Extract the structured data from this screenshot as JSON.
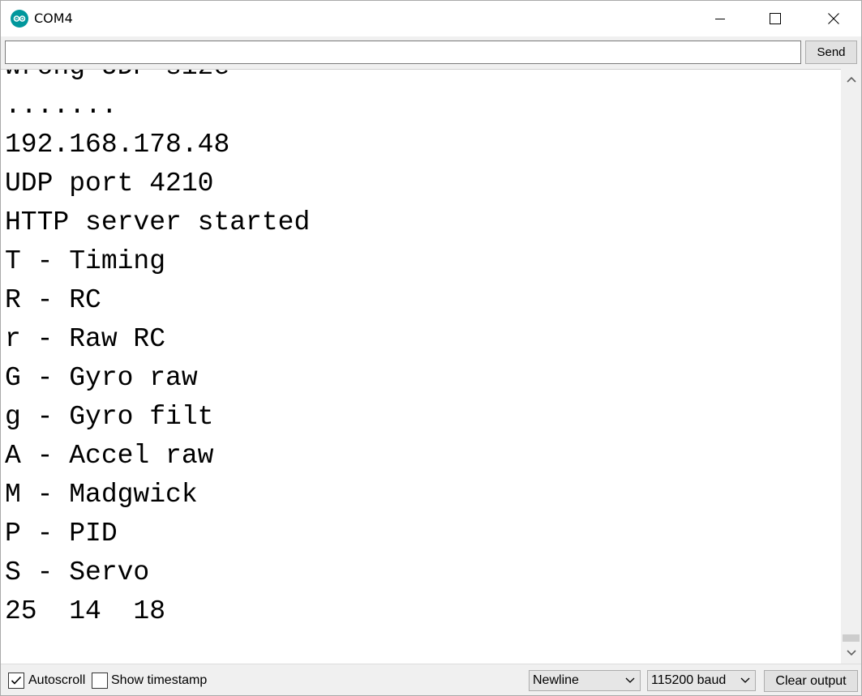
{
  "window": {
    "title": "COM4"
  },
  "input": {
    "value": "",
    "send_label": "Send"
  },
  "output": {
    "lines": [
      "wrong UDP size",
      ".......",
      "192.168.178.48",
      "UDP port 4210",
      "HTTP server started",
      "T - Timing",
      "R - RC",
      "r - Raw RC",
      "G - Gyro raw",
      "g - Gyro filt",
      "A - Accel raw",
      "M - Madgwick",
      "P - PID",
      "S - Servo",
      "25  14  18"
    ]
  },
  "footer": {
    "autoscroll_label": "Autoscroll",
    "autoscroll_checked": true,
    "timestamp_label": "Show timestamp",
    "timestamp_checked": false,
    "line_ending": "Newline",
    "baud_rate": "115200 baud",
    "clear_label": "Clear output"
  },
  "colors": {
    "arduino_teal": "#00979c"
  },
  "icons": {
    "app": "arduino-icon",
    "minimize": "minimize-icon",
    "maximize": "maximize-icon",
    "close": "close-icon"
  }
}
